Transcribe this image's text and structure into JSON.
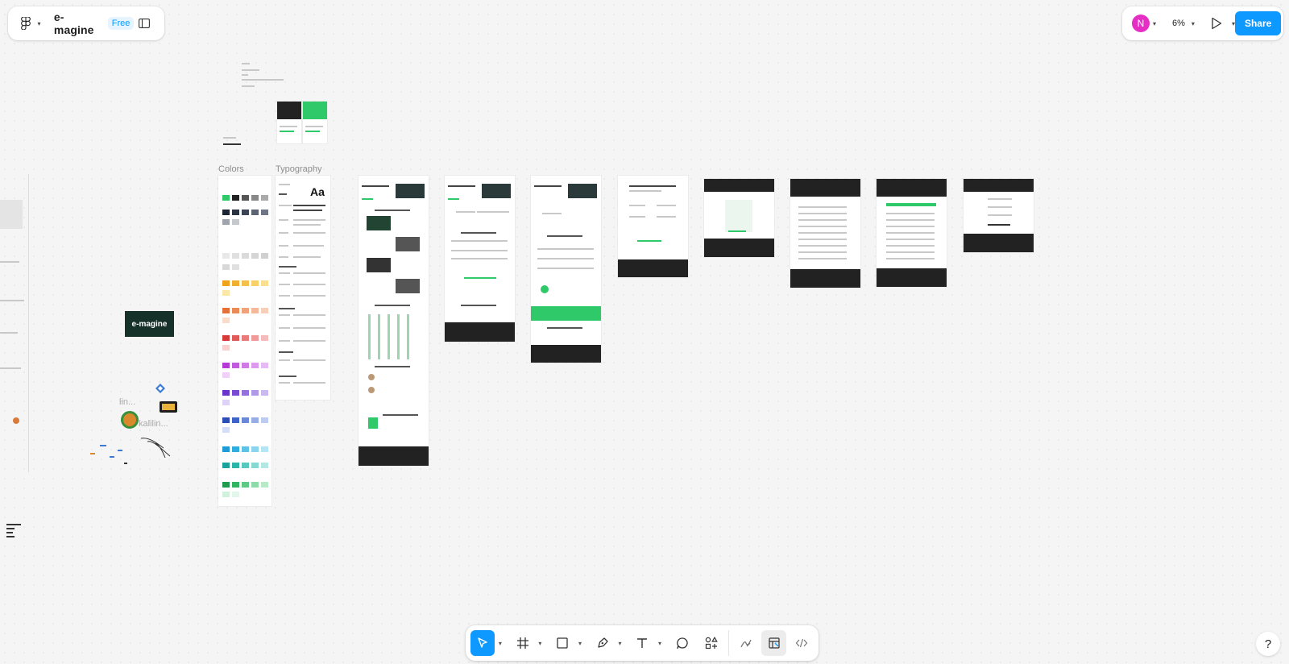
{
  "header": {
    "file_title": "e-magine",
    "plan_badge": "Free"
  },
  "top_right": {
    "avatar_initial": "N",
    "avatar_color": "#e42ec4",
    "zoom_level": "6%",
    "share_label": "Share"
  },
  "canvas": {
    "colors_label": "Colors",
    "typography_label": "Typography",
    "typography_sample": "Aa",
    "logo_text": "e-magine",
    "cursor_label_1": "lin...",
    "cursor_label_2": "kalilin..."
  },
  "toolbar": {
    "tools": [
      "move-tool",
      "frame-tool",
      "shape-tool",
      "pen-tool",
      "text-tool",
      "comment-tool",
      "actions-tool",
      "draw-mode",
      "design-mode",
      "dev-mode"
    ]
  },
  "help": {
    "label": "?"
  },
  "colors": {
    "accent": "#0d99ff",
    "brand_green": "#2fc96a",
    "dark": "#222222"
  }
}
